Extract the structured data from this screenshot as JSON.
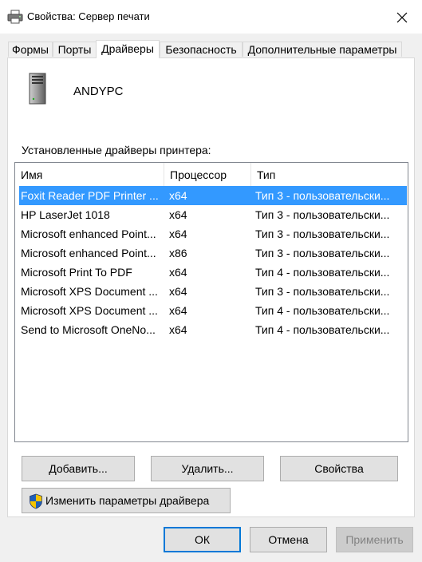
{
  "window": {
    "title": "Свойства: Сервер печати",
    "icon": "printer-icon",
    "close_icon": "close-icon"
  },
  "tabs": [
    {
      "label": "Формы",
      "active": false
    },
    {
      "label": "Порты",
      "active": false
    },
    {
      "label": "Драйверы",
      "active": true
    },
    {
      "label": "Безопасность",
      "active": false
    },
    {
      "label": "Дополнительные параметры",
      "active": false
    }
  ],
  "server": {
    "name": "ANDYPC",
    "icon": "server-icon"
  },
  "drivers_label": "Установленные драйверы принтера:",
  "list": {
    "columns": [
      "Имя",
      "Процессор",
      "Тип"
    ],
    "rows": [
      {
        "name": "Foxit Reader PDF Printer ...",
        "processor": "x64",
        "type": "Тип 3 - пользовательски...",
        "selected": true
      },
      {
        "name": "HP LaserJet 1018",
        "processor": "x64",
        "type": "Тип 3 - пользовательски...",
        "selected": false
      },
      {
        "name": "Microsoft enhanced Point...",
        "processor": "x64",
        "type": "Тип 3 - пользовательски...",
        "selected": false
      },
      {
        "name": "Microsoft enhanced Point...",
        "processor": "x86",
        "type": "Тип 3 - пользовательски...",
        "selected": false
      },
      {
        "name": "Microsoft Print To PDF",
        "processor": "x64",
        "type": "Тип 4 - пользовательски...",
        "selected": false
      },
      {
        "name": "Microsoft XPS Document ...",
        "processor": "x64",
        "type": "Тип 3 - пользовательски...",
        "selected": false
      },
      {
        "name": "Microsoft XPS Document ...",
        "processor": "x64",
        "type": "Тип 4 - пользовательски...",
        "selected": false
      },
      {
        "name": "Send to Microsoft OneNo...",
        "processor": "x64",
        "type": "Тип 4 - пользовательски...",
        "selected": false
      }
    ]
  },
  "buttons": {
    "add": "Добавить...",
    "remove": "Удалить...",
    "properties": "Свойства",
    "change_settings": "Изменить параметры драйвера",
    "ok": "ОК",
    "cancel": "Отмена",
    "apply": "Применить"
  },
  "colors": {
    "selection": "#3399ff",
    "accent": "#0078d7",
    "shield_blue": "#1f5fb8",
    "shield_yellow": "#f5c400"
  }
}
